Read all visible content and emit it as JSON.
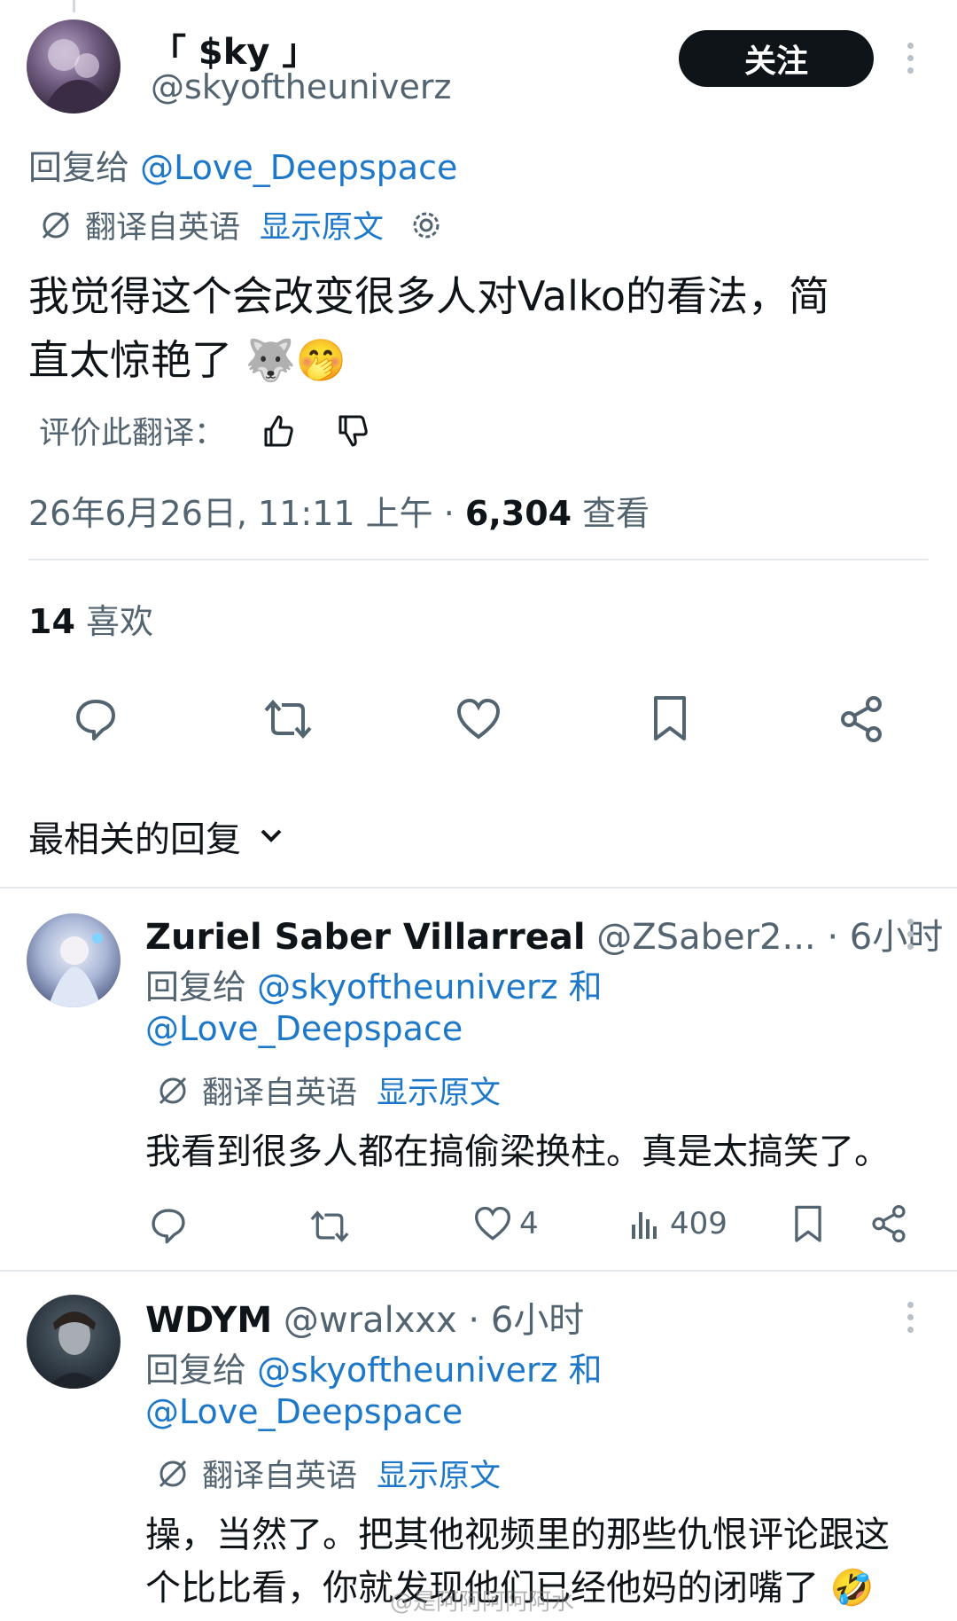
{
  "main_tweet": {
    "display_name": "「 $ky 」",
    "handle": "@skyoftheuniverz",
    "follow_label": "关注",
    "reply_to_prefix": "回复给",
    "reply_to_handle": "@Love_Deepspace",
    "translated_from": "翻译自英语",
    "show_original": "显示原文",
    "text_line1": "我觉得这个会改变很多人对Valko的看法，简",
    "text_line2": "直太惊艳了 🐺🤭",
    "rate_label": "评价此翻译：",
    "timestamp": "26年6月26日, 11:11 上午 · ",
    "views_count": "6,304",
    "views_label": " 查看",
    "likes_count": "14",
    "likes_label": " 喜欢"
  },
  "sort": {
    "label": "最相关的回复"
  },
  "replies": [
    {
      "name": "Zuriel Saber Villarreal",
      "handle": "@ZSaber2...",
      "time": " · 6小时",
      "reply_prefix": "回复给",
      "reply_handle1": "@skyoftheuniverz",
      "reply_and": " 和",
      "reply_handle2": "@Love_Deepspace",
      "translated_from": "翻译自英语",
      "show_original": "显示原文",
      "text_line1": "我看到很多人都在搞偷梁换柱。真是太搞笑了。",
      "likes": "4",
      "views": "409"
    },
    {
      "name": "WDYM",
      "handle": "@wralxxx",
      "time": " · 6小时",
      "reply_prefix": "回复给",
      "reply_handle1": "@skyoftheuniverz",
      "reply_and": " 和",
      "reply_handle2": "@Love_Deepspace",
      "translated_from": "翻译自英语",
      "show_original": "显示原文",
      "text_line1": "操，当然了。把其他视频里的那些仇恨评论跟这",
      "text_line2": "个比比看，你就发现他们已经他妈的闭嘴了 🤣"
    }
  ],
  "watermark": "@是阿阿阿阿阿水",
  "colors": {
    "link": "#1d78c9",
    "text": "#0f1419",
    "muted": "#536471"
  }
}
